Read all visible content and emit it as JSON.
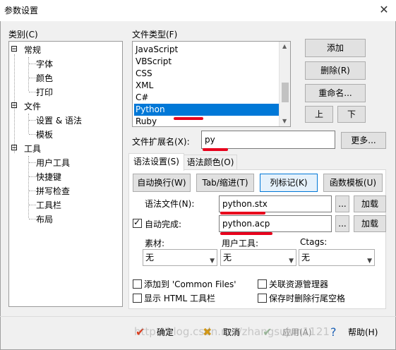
{
  "window": {
    "title": "参数设置"
  },
  "category": {
    "label": "类别(C)",
    "items": [
      {
        "label": "常规",
        "sign": "⊟"
      },
      {
        "label": "字体"
      },
      {
        "label": "颜色"
      },
      {
        "label": "打印"
      },
      {
        "label": "文件",
        "sign": "⊟"
      },
      {
        "label": "设置 & 语法"
      },
      {
        "label": "模板"
      },
      {
        "label": "工具",
        "sign": "⊟"
      },
      {
        "label": "用户工具"
      },
      {
        "label": "快捷键"
      },
      {
        "label": "拼写检查"
      },
      {
        "label": "工具栏"
      },
      {
        "label": "布局"
      }
    ]
  },
  "filetype": {
    "label": "文件类型(F)",
    "items": [
      "JavaScript",
      "VBScript",
      "CSS",
      "XML",
      "C#",
      "Python",
      "Ruby"
    ],
    "selected": "Python"
  },
  "side_buttons": {
    "add": "添加",
    "delete": "删除(R)",
    "rename": "重命名...",
    "up": "上",
    "down": "下"
  },
  "extension": {
    "label": "文件扩展名(X):",
    "value": "py",
    "more": "更多..."
  },
  "tabs": {
    "syntax_settings": "语法设置(S)",
    "syntax_colors": "语法颜色(O)"
  },
  "mode_buttons": {
    "autowrap": "自动换行(W)",
    "tab_indent": "Tab/缩进(T)",
    "column_marker": "列标记(K)",
    "func_template": "函数模板(U)"
  },
  "syntax_file": {
    "label": "语法文件(N):",
    "value": "python.stx",
    "browse": "...",
    "load": "加载"
  },
  "autocomplete": {
    "label": "自动完成:",
    "checked": true,
    "value": "python.acp",
    "browse": "...",
    "load": "加载"
  },
  "dropdowns": [
    {
      "label": "素材:",
      "value": "无"
    },
    {
      "label": "用户工具:",
      "value": "无"
    },
    {
      "label": "Ctags:",
      "value": "无"
    }
  ],
  "checkboxes": {
    "add_common": "添加到 'Common Files'",
    "associate_explorer": "关联资源管理器",
    "show_html_toolbar": "显示 HTML 工具栏",
    "trim_trailing": "保存时删除行尾空格"
  },
  "footer": {
    "ok": "确定",
    "cancel": "取消",
    "apply": "应用(A)",
    "help": "帮助(H)"
  },
  "watermark": "http://blog.csdn.net/zhangsujun1121",
  "colors": {
    "selection": "#0078d7",
    "annotation": "#e8001c",
    "focus_border": "#0078d7"
  }
}
